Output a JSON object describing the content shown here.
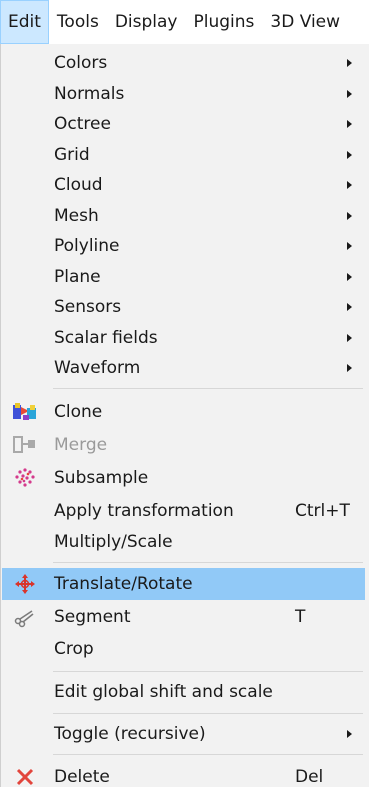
{
  "menubar": {
    "items": [
      {
        "label": "Edit"
      },
      {
        "label": "Tools"
      },
      {
        "label": "Display"
      },
      {
        "label": "Plugins"
      },
      {
        "label": "3D View"
      }
    ]
  },
  "menu": {
    "submenus": [
      {
        "label": "Colors"
      },
      {
        "label": "Normals"
      },
      {
        "label": "Octree"
      },
      {
        "label": "Grid"
      },
      {
        "label": "Cloud"
      },
      {
        "label": "Mesh"
      },
      {
        "label": "Polyline"
      },
      {
        "label": "Plane"
      },
      {
        "label": "Sensors"
      },
      {
        "label": "Scalar fields"
      },
      {
        "label": "Waveform"
      }
    ],
    "clone": {
      "label": "Clone",
      "icon": "clone-icon"
    },
    "merge": {
      "label": "Merge",
      "icon": "merge-icon",
      "disabled": true
    },
    "subsample": {
      "label": "Subsample",
      "icon": "subsample-icon"
    },
    "apply_transformation": {
      "label": "Apply transformation",
      "shortcut": "Ctrl+T"
    },
    "multiply_scale": {
      "label": "Multiply/Scale"
    },
    "translate_rotate": {
      "label": "Translate/Rotate",
      "icon": "translate-rotate-icon",
      "highlighted": true
    },
    "segment": {
      "label": "Segment",
      "shortcut": "T",
      "icon": "scissors-icon"
    },
    "crop": {
      "label": "Crop"
    },
    "edit_global_shift": {
      "label": "Edit global shift and scale"
    },
    "toggle_recursive": {
      "label": "Toggle (recursive)"
    },
    "delete": {
      "label": "Delete",
      "shortcut": "Del",
      "icon": "delete-icon"
    }
  },
  "colors": {
    "highlight": "#91c9f7",
    "menu_bg": "#f2f2f2",
    "active_menubar": "#cce8ff",
    "delete_icon": "#e2453c"
  }
}
